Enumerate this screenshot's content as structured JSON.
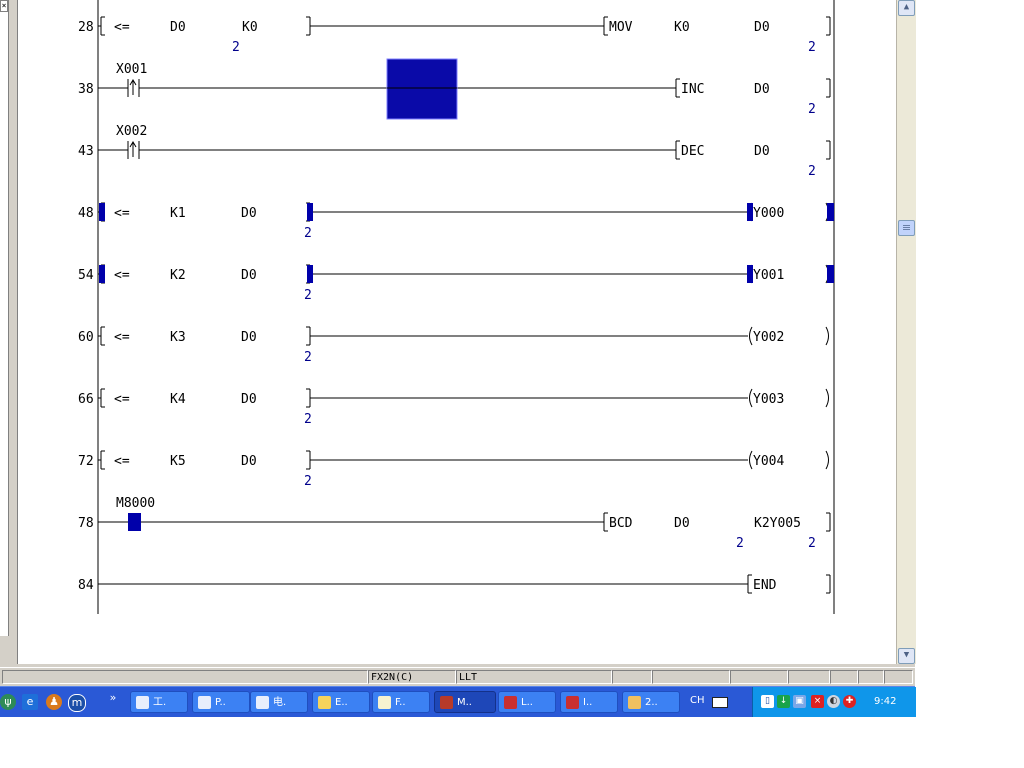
{
  "ladder": {
    "rungs": [
      {
        "step": "28",
        "bracket": "[",
        "elems": [
          {
            "t": "<=",
            "k": "op"
          },
          {
            "t": "D0",
            "k": "o1"
          },
          {
            "t": "K0",
            "k": "o2"
          }
        ],
        "sub": [
          {
            "t": "2",
            "k": "o2s"
          }
        ],
        "contact": null,
        "output": "MOV",
        "outK": "cmdM",
        "operands": [
          {
            "t": "K0",
            "k": "a"
          },
          {
            "t": "D0",
            "k": "b"
          }
        ],
        "osub": [
          {
            "t": "2",
            "k": "end"
          }
        ],
        "close": "]"
      },
      {
        "step": "38",
        "bracket": "",
        "elems": [],
        "sub": [],
        "contact": "X001",
        "output": "INC",
        "outK": "cmdI",
        "operands": [
          {
            "t": "D0",
            "k": "b"
          }
        ],
        "osub": [
          {
            "t": "2",
            "k": "end"
          }
        ],
        "close": "]"
      },
      {
        "step": "43",
        "bracket": "",
        "elems": [],
        "sub": [],
        "contact": "X002",
        "output": "DEC",
        "outK": "cmdI",
        "operands": [
          {
            "t": "D0",
            "k": "b"
          }
        ],
        "osub": [
          {
            "t": "2",
            "k": "end"
          }
        ],
        "close": "]"
      },
      {
        "step": "48",
        "bracket": "[",
        "elems": [
          {
            "t": "<=",
            "k": "op"
          },
          {
            "t": "K1",
            "k": "o1b"
          },
          {
            "t": "D0",
            "k": "o2b"
          }
        ],
        "sub": [
          {
            "t": "2",
            "k": "o3s"
          }
        ],
        "contact": null,
        "output": "Y000",
        "outK": "coil",
        "operands": [],
        "osub": [],
        "close": ")"
      },
      {
        "step": "54",
        "bracket": "[",
        "elems": [
          {
            "t": "<=",
            "k": "op"
          },
          {
            "t": "K2",
            "k": "o1b"
          },
          {
            "t": "D0",
            "k": "o2b"
          }
        ],
        "sub": [
          {
            "t": "2",
            "k": "o3s"
          }
        ],
        "contact": null,
        "output": "Y001",
        "outK": "coil",
        "operands": [],
        "osub": [],
        "close": ")"
      },
      {
        "step": "60",
        "bracket": "[",
        "elems": [
          {
            "t": "<=",
            "k": "op"
          },
          {
            "t": "K3",
            "k": "o1b"
          },
          {
            "t": "D0",
            "k": "o2b"
          }
        ],
        "sub": [
          {
            "t": "2",
            "k": "o3s"
          }
        ],
        "contact": null,
        "output": "Y002",
        "outK": "coil",
        "operands": [],
        "osub": [],
        "close": ")"
      },
      {
        "step": "66",
        "bracket": "[",
        "elems": [
          {
            "t": "<=",
            "k": "op"
          },
          {
            "t": "K4",
            "k": "o1b"
          },
          {
            "t": "D0",
            "k": "o2b"
          }
        ],
        "sub": [
          {
            "t": "2",
            "k": "o3s"
          }
        ],
        "contact": null,
        "output": "Y003",
        "outK": "coil",
        "operands": [],
        "osub": [],
        "close": ")"
      },
      {
        "step": "72",
        "bracket": "[",
        "elems": [
          {
            "t": "<=",
            "k": "op"
          },
          {
            "t": "K5",
            "k": "o1b"
          },
          {
            "t": "D0",
            "k": "o2b"
          }
        ],
        "sub": [
          {
            "t": "2",
            "k": "o3s"
          }
        ],
        "contact": null,
        "output": "Y004",
        "outK": "coil",
        "operands": [],
        "osub": [],
        "close": ")"
      },
      {
        "step": "78",
        "bracket": "",
        "elems": [],
        "sub": [],
        "contact": "M8000",
        "output": "BCD",
        "outK": "cmdM",
        "operands": [
          {
            "t": "D0",
            "k": "a"
          },
          {
            "t": "K2Y005",
            "k": "b"
          }
        ],
        "osub": [
          {
            "t": "2",
            "k": "mid"
          },
          {
            "t": "2",
            "k": "end"
          }
        ],
        "close": "]"
      },
      {
        "step": "84",
        "bracket": "",
        "elems": [],
        "sub": [],
        "contact": null,
        "output": "END",
        "outK": "coil",
        "operands": [],
        "osub": [],
        "close": "]"
      }
    ]
  },
  "status": {
    "plc_type": "FX2N(C)",
    "mode": "LLT"
  },
  "taskbar": {
    "quick_chevron": "»",
    "buttons": [
      {
        "label": "工.",
        "icon": "word-icon",
        "color": "#e8eefc"
      },
      {
        "label": "P..",
        "icon": "word-icon",
        "color": "#e8eefc"
      },
      {
        "label": "电.",
        "icon": "word-icon",
        "color": "#e8eefc"
      },
      {
        "label": "E..",
        "icon": "folder-icon",
        "color": "#f6d35b"
      },
      {
        "label": "F..",
        "icon": "pencil-icon",
        "color": "#f7f2d0"
      },
      {
        "label": "M..",
        "icon": "gx-developer-icon",
        "color": "#b73a2a"
      },
      {
        "label": "L..",
        "icon": "app-icon",
        "color": "#c93030"
      },
      {
        "label": "I..",
        "icon": "app-icon",
        "color": "#c93030"
      },
      {
        "label": "2..",
        "icon": "paint-icon",
        "color": "#f0c060"
      }
    ],
    "lang": "CH",
    "clock": "9:42"
  },
  "colors": {
    "ladder_line": "#000000",
    "annot": "#00008b",
    "cursor": "#0000aa",
    "select": "#0a0aa8"
  }
}
